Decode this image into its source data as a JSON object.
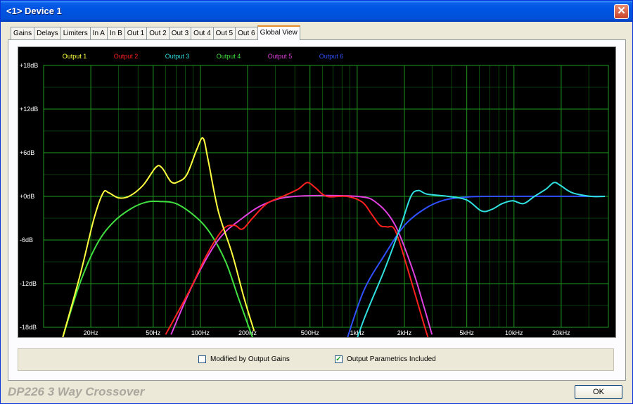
{
  "window": {
    "title": "<1> Device 1",
    "close_glyph": "✕",
    "close_icon": "close-icon"
  },
  "tabs": [
    "Gains",
    "Delays",
    "Limiters",
    "In A",
    "In B",
    "Out 1",
    "Out 2",
    "Out 3",
    "Out 4",
    "Out 5",
    "Out 6",
    "Global View"
  ],
  "active_tab": "Global View",
  "options": {
    "modified_gains": {
      "label": "Modified by Output Gains",
      "checked": false
    },
    "parametrics": {
      "label": "Output Parametrics Included",
      "checked": true
    }
  },
  "footer": {
    "title": "DP226 3 Way Crossover",
    "ok_label": "OK"
  },
  "colors": {
    "grid": "#1f9a1f",
    "background": "#000000",
    "axis_label": "#ffffff"
  },
  "chart_data": {
    "type": "line",
    "x_scale": "log",
    "xlim": [
      10,
      40000
    ],
    "ylim": [
      -18,
      18
    ],
    "grid": true,
    "legend_position": "top",
    "x_ticks": [
      {
        "v": 20,
        "label": "20Hz"
      },
      {
        "v": 50,
        "label": "50Hz"
      },
      {
        "v": 100,
        "label": "100Hz"
      },
      {
        "v": 200,
        "label": "200Hz"
      },
      {
        "v": 500,
        "label": "500Hz"
      },
      {
        "v": 1000,
        "label": "1kHz"
      },
      {
        "v": 2000,
        "label": "2kHz"
      },
      {
        "v": 5000,
        "label": "5kHz"
      },
      {
        "v": 10000,
        "label": "10kHz"
      },
      {
        "v": 20000,
        "label": "20kHz"
      }
    ],
    "y_ticks": [
      {
        "v": 18,
        "label": "+18dB"
      },
      {
        "v": 12,
        "label": "+12dB"
      },
      {
        "v": 6,
        "label": "+6dB"
      },
      {
        "v": 0,
        "label": "+0dB"
      },
      {
        "v": -6,
        "label": "-6dB"
      },
      {
        "v": -12,
        "label": "-12dB"
      },
      {
        "v": -18,
        "label": "-18dB"
      }
    ],
    "series": [
      {
        "name": "Output 1",
        "color": "#ffff40",
        "points": [
          [
            13,
            -20
          ],
          [
            17,
            -11
          ],
          [
            21,
            -3
          ],
          [
            24,
            0.5
          ],
          [
            26,
            0.5
          ],
          [
            30,
            -0.2
          ],
          [
            35,
            0
          ],
          [
            43,
            1.5
          ],
          [
            52,
            4
          ],
          [
            57,
            3.9
          ],
          [
            65,
            2
          ],
          [
            72,
            2
          ],
          [
            82,
            3
          ],
          [
            95,
            6.5
          ],
          [
            104,
            8
          ],
          [
            112,
            5
          ],
          [
            130,
            -2
          ],
          [
            160,
            -8
          ],
          [
            190,
            -14
          ],
          [
            220,
            -18.5
          ]
        ]
      },
      {
        "name": "Output 2",
        "color": "#ff2020",
        "points": [
          [
            60,
            -19
          ],
          [
            85,
            -13
          ],
          [
            110,
            -8
          ],
          [
            140,
            -4.5
          ],
          [
            165,
            -4
          ],
          [
            185,
            -4.5
          ],
          [
            215,
            -3
          ],
          [
            265,
            -1
          ],
          [
            335,
            0
          ],
          [
            420,
            1
          ],
          [
            480,
            1.9
          ],
          [
            540,
            1.2
          ],
          [
            640,
            0
          ],
          [
            860,
            0
          ],
          [
            1080,
            -0.8
          ],
          [
            1240,
            -2.5
          ],
          [
            1400,
            -4
          ],
          [
            1550,
            -4.2
          ],
          [
            1750,
            -4.7
          ],
          [
            2100,
            -10
          ],
          [
            2700,
            -18
          ],
          [
            3100,
            -22
          ]
        ]
      },
      {
        "name": "Output 3",
        "color": "#30e0e0",
        "points": [
          [
            850,
            -24
          ],
          [
            1100,
            -17
          ],
          [
            1500,
            -10
          ],
          [
            1900,
            -4
          ],
          [
            2200,
            0
          ],
          [
            2450,
            0.8
          ],
          [
            2800,
            0.3
          ],
          [
            3800,
            0
          ],
          [
            5000,
            -0.5
          ],
          [
            6200,
            -2
          ],
          [
            7200,
            -1.8
          ],
          [
            8400,
            -1
          ],
          [
            9800,
            -0.6
          ],
          [
            11500,
            -1
          ],
          [
            13500,
            0
          ],
          [
            16000,
            1
          ],
          [
            18000,
            1.9
          ],
          [
            19800,
            1.5
          ],
          [
            23500,
            0.5
          ],
          [
            31000,
            0
          ],
          [
            38000,
            0
          ]
        ]
      },
      {
        "name": "Output 4",
        "color": "#40e040",
        "points": [
          [
            13,
            -20
          ],
          [
            17,
            -12
          ],
          [
            22,
            -6.5
          ],
          [
            28,
            -3.5
          ],
          [
            36,
            -1.7
          ],
          [
            45,
            -0.8
          ],
          [
            55,
            -0.7
          ],
          [
            70,
            -1
          ],
          [
            92,
            -2.7
          ],
          [
            115,
            -5
          ],
          [
            145,
            -9
          ],
          [
            175,
            -14
          ],
          [
            220,
            -20
          ]
        ]
      },
      {
        "name": "Output 5",
        "color": "#e040e0",
        "points": [
          [
            65,
            -19
          ],
          [
            90,
            -12
          ],
          [
            130,
            -6
          ],
          [
            185,
            -3
          ],
          [
            260,
            -1
          ],
          [
            400,
            0
          ],
          [
            1000,
            0
          ],
          [
            1350,
            -1
          ],
          [
            1750,
            -4
          ],
          [
            2250,
            -10
          ],
          [
            2650,
            -15
          ],
          [
            3000,
            -19
          ]
        ]
      },
      {
        "name": "Output 6",
        "color": "#3050ff",
        "points": [
          [
            850,
            -20
          ],
          [
            1100,
            -13
          ],
          [
            1500,
            -8
          ],
          [
            2000,
            -4
          ],
          [
            2700,
            -1.7
          ],
          [
            3600,
            -0.5
          ],
          [
            5000,
            -0.1
          ],
          [
            7000,
            0
          ],
          [
            38000,
            0
          ]
        ]
      }
    ]
  }
}
